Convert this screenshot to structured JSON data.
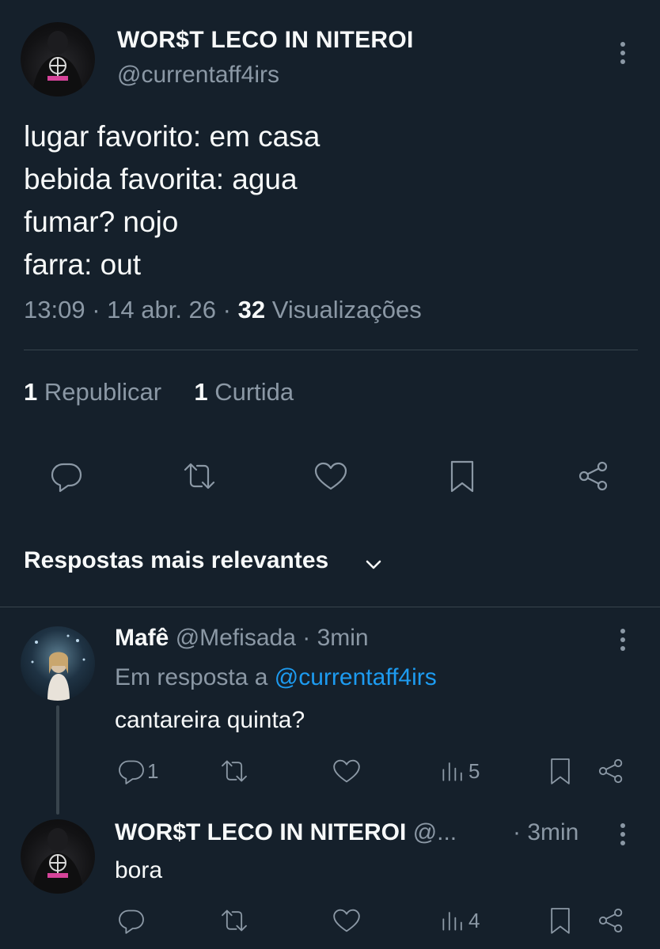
{
  "tweet": {
    "display_name": "WOR$T LECO IN NITEROI",
    "handle": "@currentaff4irs",
    "lines": [
      "lugar favorito: em casa",
      "bebida favorita: agua",
      "fumar? nojo",
      "farra: out"
    ],
    "time": "13:09",
    "date": "14 abr. 26",
    "views_count": "32",
    "views_label": "Visualizações",
    "reposts_count": "1",
    "reposts_label": "Republicar",
    "likes_count": "1",
    "likes_label": "Curtida"
  },
  "replies_header": "Respostas mais relevantes",
  "reply1": {
    "name": "Mafê",
    "handle": "@Mefisada",
    "time": "3min",
    "reply_to_prefix": "Em resposta a",
    "reply_to_handle": "@currentaff4irs",
    "text": "cantareira quinta?",
    "reply_count": "1",
    "views_count": "5"
  },
  "reply2": {
    "name": "WOR$T LECO IN NITEROI",
    "handle": "@...",
    "time": "3min",
    "text": "bora",
    "views_count": "4"
  },
  "colors": {
    "background": "#15202b",
    "text": "#f7f9f9",
    "muted": "#8b98a5",
    "link": "#1d9bf0",
    "divider": "#38444d"
  }
}
